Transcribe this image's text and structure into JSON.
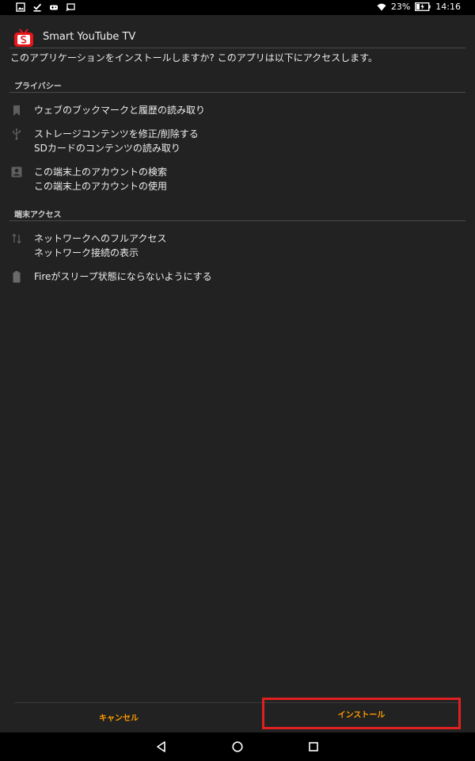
{
  "status_bar": {
    "battery_percent": "23%",
    "time": "14:16",
    "left_icons": [
      "image-icon",
      "download-done-icon",
      "game-controller-icon",
      "cast-icon"
    ],
    "right_icons": [
      "wifi-icon",
      "battery-charging-icon"
    ]
  },
  "header": {
    "app_icon": "smart-youtube-tv-logo",
    "app_title": "Smart YouTube TV"
  },
  "question": "このアプリケーションをインストールしますか? このアプリは以下にアクセスします。",
  "sections": [
    {
      "title": "プライバシー",
      "permissions": [
        {
          "icon": "bookmark-icon",
          "lines": [
            "ウェブのブックマークと履歴の読み取り"
          ]
        },
        {
          "icon": "usb-icon",
          "lines": [
            "ストレージコンテンツを修正/削除する",
            "SDカードのコンテンツの読み取り"
          ]
        },
        {
          "icon": "account-icon",
          "lines": [
            "この端末上のアカウントの検索",
            "この端末上のアカウントの使用"
          ]
        }
      ]
    },
    {
      "title": "端末アクセス",
      "permissions": [
        {
          "icon": "network-arrows-icon",
          "lines": [
            "ネットワークへのフルアクセス",
            "ネットワーク接続の表示"
          ]
        },
        {
          "icon": "battery-icon",
          "lines": [
            "Fireがスリープ状態にならないようにする"
          ]
        }
      ]
    }
  ],
  "buttons": {
    "cancel_label": "キャンセル",
    "install_label": "インストール"
  },
  "nav_bar": {
    "icons": [
      "back-icon",
      "home-icon",
      "recents-icon"
    ]
  },
  "colors": {
    "background": "#222222",
    "accent": "#ff9900",
    "highlight_box": "#e02020",
    "app_logo_red": "#e8161b"
  }
}
